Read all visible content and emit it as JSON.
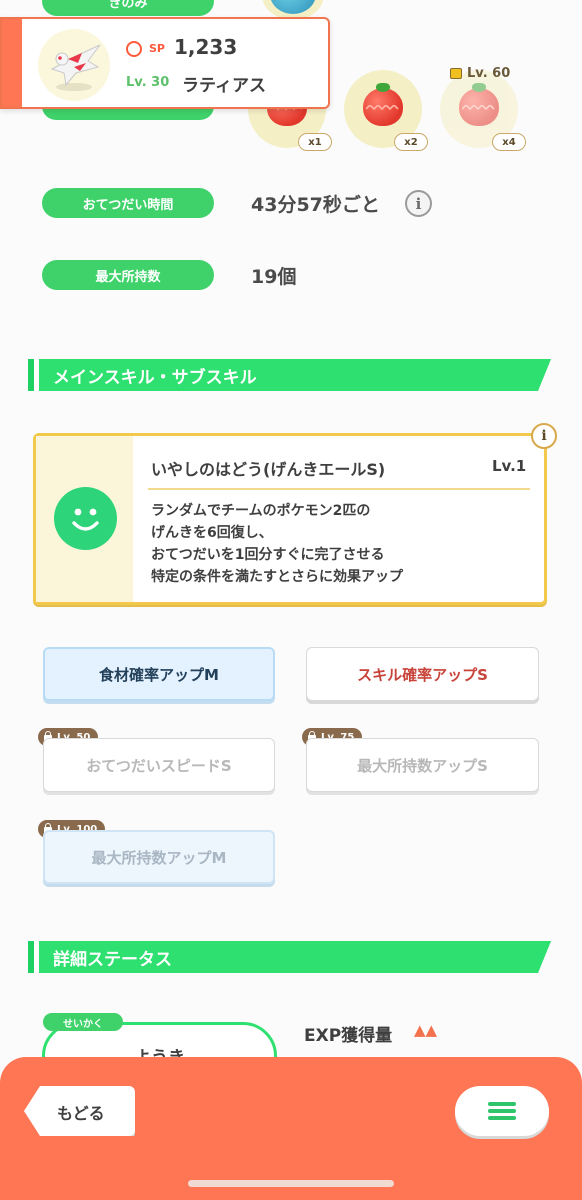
{
  "berry": {
    "label": "きのみ"
  },
  "pokemon": {
    "sp_label": "SP",
    "sp_value": "1,233",
    "level": "Lv. 30",
    "name": "ラティアス"
  },
  "ingredients": [
    {
      "qty": "x1",
      "locked": false
    },
    {
      "qty": "x2",
      "locked": false
    },
    {
      "qty": "x4",
      "locked": true,
      "unlock_level": "Lv. 60"
    }
  ],
  "stats": {
    "help_time_label": "おてつだい時間",
    "help_time_value": "43分57秒ごと",
    "max_carry_label": "最大所持数",
    "max_carry_value": "19個"
  },
  "skills_section": {
    "title": "メインスキル・サブスキル",
    "main_skill": {
      "name": "いやしのはどう(げんきエールS)",
      "level": "Lv.1",
      "description_lines": [
        "ランダムでチームのポケモン2匹の",
        "げんきを6回復し、",
        "おてつだいを1回分すぐに完了させる",
        "特定の条件を満たすとさらに効果アップ"
      ]
    },
    "sub_skills": [
      {
        "label": "食材確率アップM",
        "lock": ""
      },
      {
        "label": "スキル確率アップS",
        "lock": ""
      },
      {
        "label": "おてつだいスピードS",
        "lock": "Lv. 50"
      },
      {
        "label": "最大所持数アップS",
        "lock": "Lv. 75"
      },
      {
        "label": "最大所持数アップM",
        "lock": "Lv. 100"
      }
    ]
  },
  "detail_section": {
    "title": "詳細ステータス",
    "nature_tag": "せいかく",
    "nature_value": "ようき",
    "exp_label": "EXP獲得量",
    "exp_marks": "▲▲"
  },
  "footer": {
    "back_label": "もどる"
  },
  "colors": {
    "green": "#2ee06f",
    "footer": "#ff7654",
    "skill_red": "#c8443a",
    "sub_skill_navy": "#23405a"
  }
}
